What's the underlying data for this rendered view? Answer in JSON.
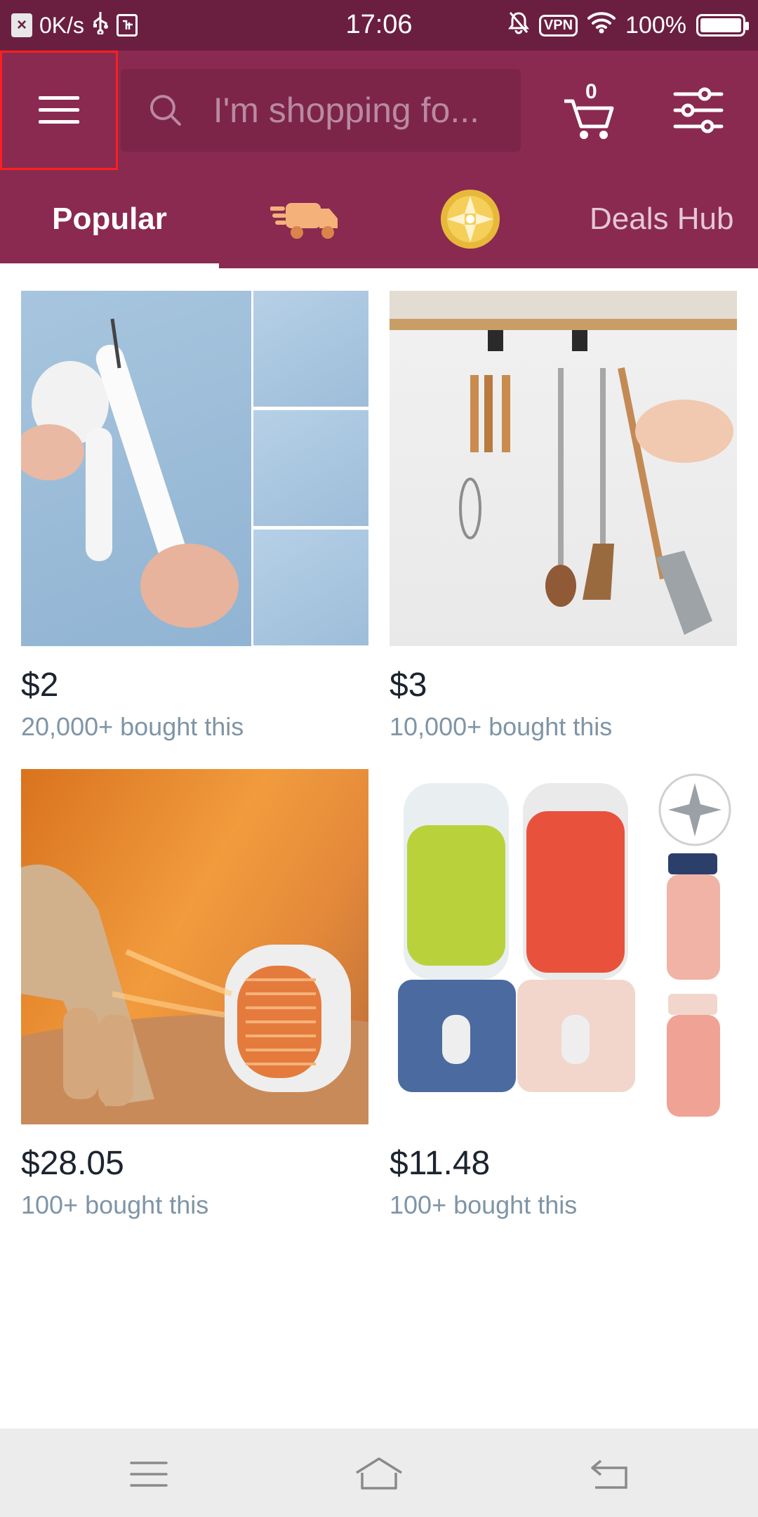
{
  "status_bar": {
    "speed": "0K/s",
    "time": "17:06",
    "vpn_label": "VPN",
    "battery": "100%",
    "battery_level": 1.0
  },
  "header": {
    "search_placeholder": "I'm shopping fo...",
    "cart_count": "0"
  },
  "tabs": [
    {
      "label": "Popular",
      "selected": true,
      "icon": null
    },
    {
      "label": "",
      "icon": "delivery-truck-icon"
    },
    {
      "label": "",
      "icon": "gold-coin-icon"
    },
    {
      "label": "Deals Hub",
      "icon": null
    }
  ],
  "products": [
    {
      "price": "$2",
      "sold": "20,000+ bought this",
      "image": "earbud-cleaning-pen"
    },
    {
      "price": "$3",
      "sold": "10,000+ bought this",
      "image": "under-shelf-utensil-hooks"
    },
    {
      "price": "$28.05",
      "sold": "100+ bought this",
      "image": "space-heater"
    },
    {
      "price": "$11.48",
      "sold": "100+ bought this",
      "image": "portable-blenders"
    }
  ],
  "colors": {
    "brand": "#8a2a50",
    "status_bar": "#6b1f40",
    "price_text": "#1c2430",
    "sold_text": "#7f95a6"
  }
}
